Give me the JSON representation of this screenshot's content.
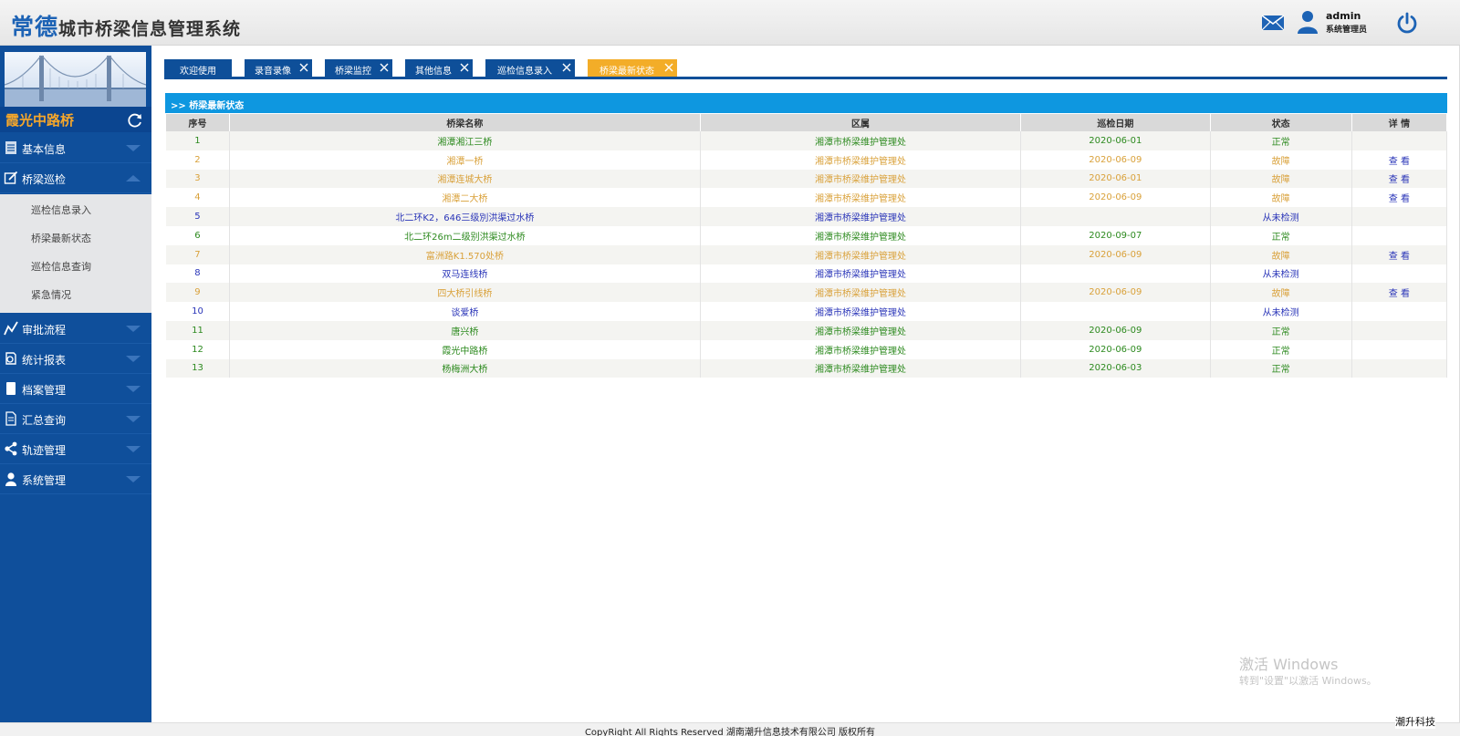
{
  "header": {
    "brand": "常德",
    "title_rest": "城市桥梁信息管理系统",
    "user_name": "admin",
    "user_role": "系统管理员"
  },
  "sidebar": {
    "bridge_name": "霞光中路桥",
    "nav": [
      {
        "label": "基本信息",
        "icon": "list-icon",
        "expanded": false
      },
      {
        "label": "桥梁巡检",
        "icon": "edit-icon",
        "expanded": true
      },
      {
        "label": "审批流程",
        "icon": "chart-line-icon",
        "expanded": false
      },
      {
        "label": "统计报表",
        "icon": "report-icon",
        "expanded": false
      },
      {
        "label": "档案管理",
        "icon": "archive-icon",
        "expanded": false
      },
      {
        "label": "汇总查询",
        "icon": "document-icon",
        "expanded": false
      },
      {
        "label": "轨迹管理",
        "icon": "share-icon",
        "expanded": false
      },
      {
        "label": "系统管理",
        "icon": "user-icon",
        "expanded": false
      }
    ],
    "submenu": [
      "巡检信息录入",
      "桥梁最新状态",
      "巡检信息查询",
      "紧急情况"
    ]
  },
  "tabs": [
    {
      "label": "欢迎使用",
      "closable": false,
      "active": false
    },
    {
      "label": "录音录像",
      "closable": true,
      "active": false
    },
    {
      "label": "桥梁监控",
      "closable": true,
      "active": false
    },
    {
      "label": "其他信息",
      "closable": true,
      "active": false
    },
    {
      "label": "巡检信息录入",
      "closable": true,
      "active": false
    },
    {
      "label": "桥梁最新状态",
      "closable": true,
      "active": true
    }
  ],
  "panel": {
    "title": ">> 桥梁最新状态"
  },
  "table": {
    "columns": [
      "序号",
      "桥梁名称",
      "区属",
      "巡检日期",
      "状态",
      "详 情"
    ],
    "status_colors": {
      "正常": "#2d8a1f",
      "故障": "#d9a13a",
      "从未检测": "#2a35b8"
    },
    "rows": [
      {
        "no": "1",
        "name": "湘潭湘江三桥",
        "district": "湘潭市桥梁维护管理处",
        "date": "2020-06-01",
        "status": "正常",
        "detail": ""
      },
      {
        "no": "2",
        "name": "湘潭一桥",
        "district": "湘潭市桥梁维护管理处",
        "date": "2020-06-09",
        "status": "故障",
        "detail": "查 看"
      },
      {
        "no": "3",
        "name": "湘潭连城大桥",
        "district": "湘潭市桥梁维护管理处",
        "date": "2020-06-01",
        "status": "故障",
        "detail": "查 看"
      },
      {
        "no": "4",
        "name": "湘潭二大桥",
        "district": "湘潭市桥梁维护管理处",
        "date": "2020-06-09",
        "status": "故障",
        "detail": "查 看"
      },
      {
        "no": "5",
        "name": "北二环K2，646三级別洪渠过水桥",
        "district": "湘潭市桥梁维护管理处",
        "date": "",
        "status": "从未检测",
        "detail": ""
      },
      {
        "no": "6",
        "name": "北二环26m二级别洪渠过水桥",
        "district": "湘潭市桥梁维护管理处",
        "date": "2020-09-07",
        "status": "正常",
        "detail": ""
      },
      {
        "no": "7",
        "name": "富洲路K1.570处桥",
        "district": "湘潭市桥梁维护管理处",
        "date": "2020-06-09",
        "status": "故障",
        "detail": "查 看"
      },
      {
        "no": "8",
        "name": "双马连线桥",
        "district": "湘潭市桥梁维护管理处",
        "date": "",
        "status": "从未检测",
        "detail": ""
      },
      {
        "no": "9",
        "name": "四大桥引线桥",
        "district": "湘潭市桥梁维护管理处",
        "date": "2020-06-09",
        "status": "故障",
        "detail": "查 看"
      },
      {
        "no": "10",
        "name": "谈爱桥",
        "district": "湘潭市桥梁维护管理处",
        "date": "",
        "status": "从未检测",
        "detail": ""
      },
      {
        "no": "11",
        "name": "唐兴桥",
        "district": "湘潭市桥梁维护管理处",
        "date": "2020-06-09",
        "status": "正常",
        "detail": ""
      },
      {
        "no": "12",
        "name": "霞光中路桥",
        "district": "湘潭市桥梁维护管理处",
        "date": "2020-06-09",
        "status": "正常",
        "detail": ""
      },
      {
        "no": "13",
        "name": "杨梅洲大桥",
        "district": "湘潭市桥梁维护管理处",
        "date": "2020-06-03",
        "status": "正常",
        "detail": ""
      }
    ]
  },
  "watermark": {
    "line1": "激活 Windows",
    "line2": "转到\"设置\"以激活 Windows。"
  },
  "footer": {
    "copyright": "CopyRight All Rights Reserved 湖南潮升信息技术有限公司 版权所有",
    "corner": "潮升科技"
  }
}
